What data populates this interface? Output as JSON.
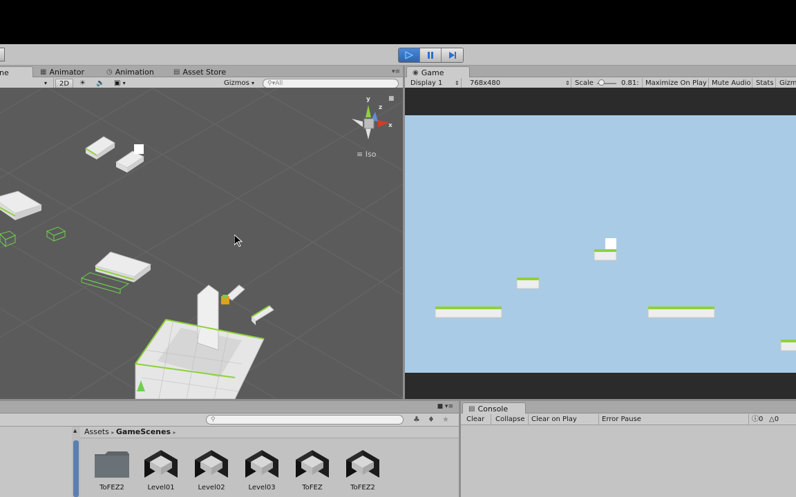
{
  "toolbar": {
    "play_icon": "play-icon",
    "pause_icon": "pause-icon",
    "step_icon": "step-icon"
  },
  "scene_tabs": {
    "partial_tab": "ne",
    "animator": "Animator",
    "animation": "Animation",
    "asset_store": "Asset Store"
  },
  "scene_bar": {
    "mode_2d": "2D",
    "gizmos": "Gizmos",
    "search_placeholder": "All"
  },
  "scene_view": {
    "gizmo_y": "y",
    "gizmo_z": "z",
    "gizmo_x": "x",
    "projection": "Iso"
  },
  "game_tab": {
    "title": "Game"
  },
  "game_bar": {
    "display": "Display 1",
    "resolution": "768x480",
    "scale_label": "Scale",
    "scale_value": "0.81:",
    "maximize": "Maximize On Play",
    "mute": "Mute Audio",
    "stats": "Stats",
    "gizmos": "Gizm"
  },
  "project": {
    "breadcrumb_root": "Assets",
    "breadcrumb_folder": "GameScenes",
    "assets": [
      {
        "name": "ToFEZ2",
        "kind": "folder"
      },
      {
        "name": "Level01",
        "kind": "unity"
      },
      {
        "name": "Level02",
        "kind": "unity"
      },
      {
        "name": "Level03",
        "kind": "unity"
      },
      {
        "name": "ToFEZ",
        "kind": "unity"
      },
      {
        "name": "ToFEZ2",
        "kind": "unity"
      }
    ]
  },
  "console": {
    "title": "Console",
    "clear": "Clear",
    "collapse": "Collapse",
    "clear_on_play": "Clear on Play",
    "error_pause": "Error Pause",
    "info_count": "0",
    "warn_count": "0"
  },
  "colors": {
    "sky": "#a9cbe5",
    "scene_bg": "#5b5b5b",
    "grass": "#8fd13a",
    "play_active": "#3a74c4"
  }
}
